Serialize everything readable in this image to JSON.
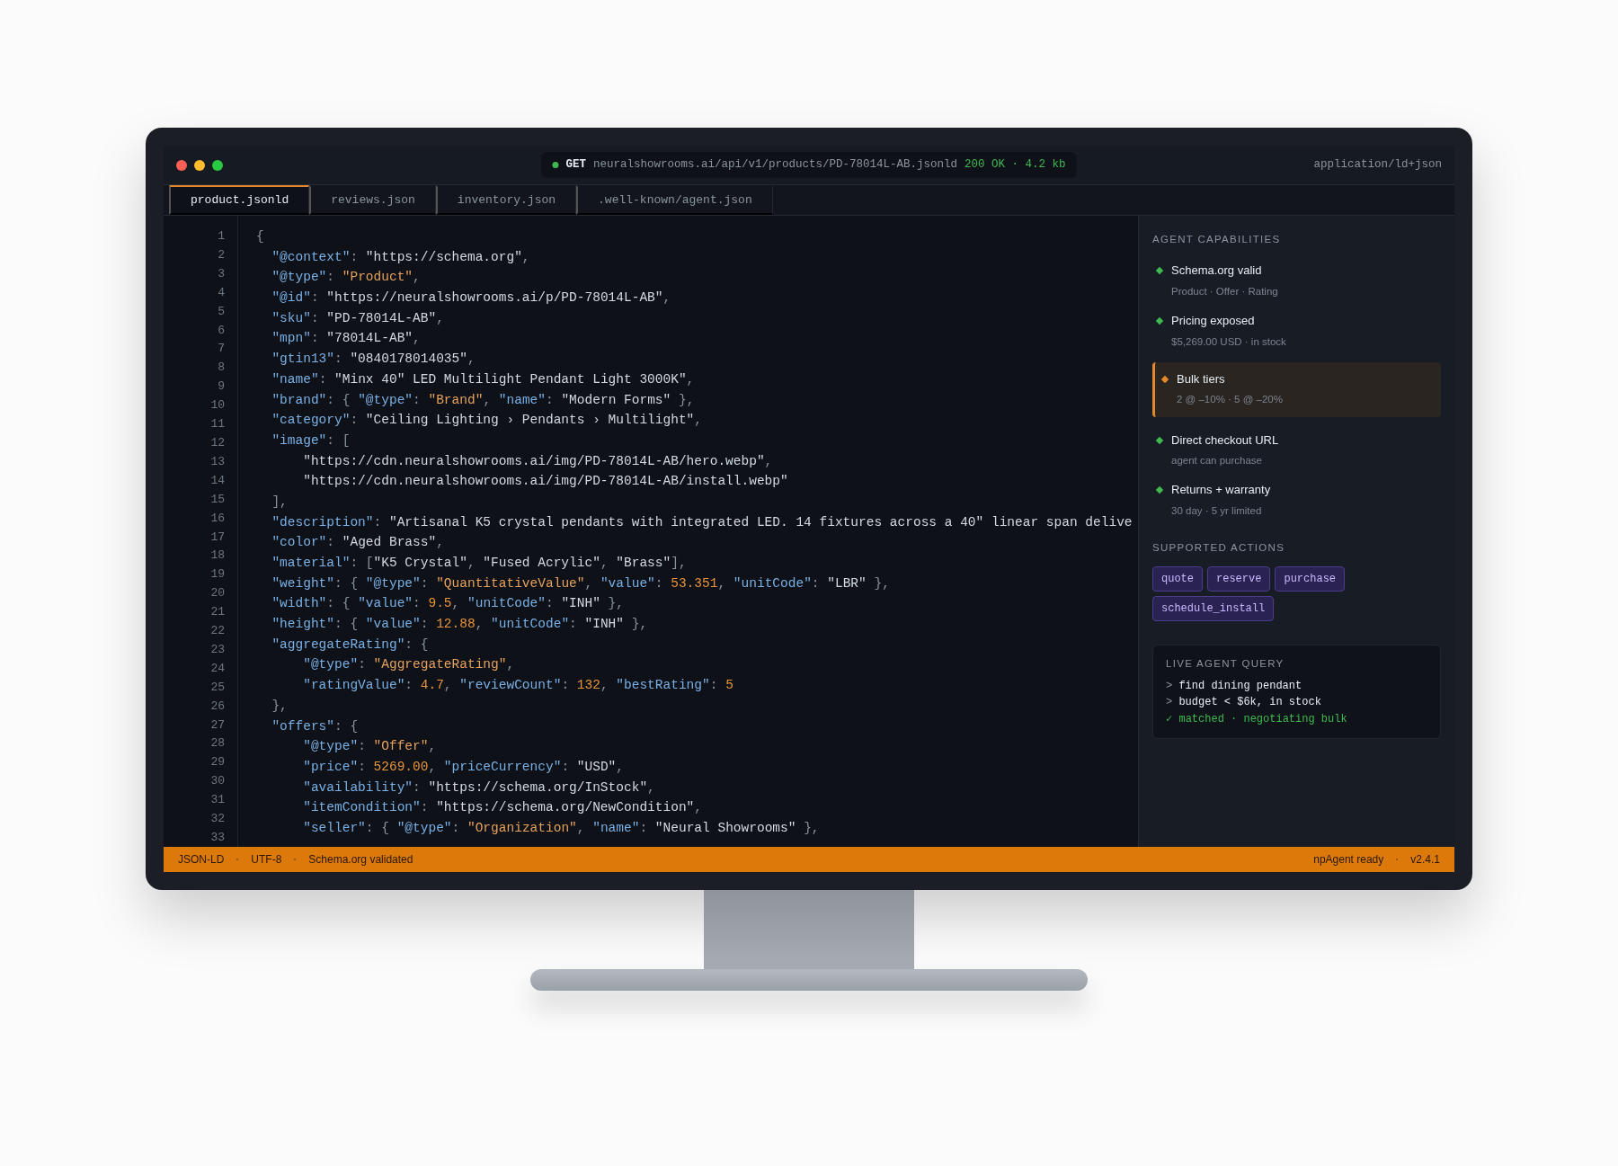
{
  "title_bar": {
    "method": "GET",
    "url": "neuralshowrooms.ai/api/v1/products/PD-78014L-AB.jsonld",
    "response": "200 OK · 4.2 kb",
    "content_type": "application/ld+json"
  },
  "tabs": [
    {
      "label": "product.jsonld",
      "selected": true
    },
    {
      "label": "reviews.json",
      "selected": false
    },
    {
      "label": "inventory.json",
      "selected": false
    },
    {
      "label": ".well-known/agent.json",
      "selected": false
    }
  ],
  "editor": {
    "line_numbers": [
      "1",
      "2",
      "3",
      "4",
      "5",
      "6",
      "7",
      "8",
      "9",
      "10",
      "11",
      "12",
      "13",
      "14",
      "15",
      "16",
      "17",
      "18",
      "19",
      "20",
      "21",
      "22",
      "23",
      "24",
      "25",
      "26",
      "27",
      "28",
      "29",
      "30",
      "31",
      "32",
      "33"
    ],
    "lines": [
      [
        {
          "kind": "punct",
          "text": "{"
        }
      ],
      [
        {
          "kind": "key",
          "text": "  \"@context\""
        },
        {
          "kind": "punct",
          "text": ": "
        },
        {
          "kind": "string",
          "text": "\"https://schema.org\""
        },
        {
          "kind": "punct",
          "text": ","
        }
      ],
      [
        {
          "kind": "key",
          "text": "  \"@type\""
        },
        {
          "kind": "punct",
          "text": ": "
        },
        {
          "kind": "type",
          "text": "\"Product\""
        },
        {
          "kind": "punct",
          "text": ","
        }
      ],
      [
        {
          "kind": "key",
          "text": "  \"@id\""
        },
        {
          "kind": "punct",
          "text": ": "
        },
        {
          "kind": "string",
          "text": "\"https://neuralshowrooms.ai/p/PD-78014L-AB\""
        },
        {
          "kind": "punct",
          "text": ","
        }
      ],
      [
        {
          "kind": "key",
          "text": "  \"sku\""
        },
        {
          "kind": "punct",
          "text": ": "
        },
        {
          "kind": "string",
          "text": "\"PD-78014L-AB\""
        },
        {
          "kind": "punct",
          "text": ","
        }
      ],
      [
        {
          "kind": "key",
          "text": "  \"mpn\""
        },
        {
          "kind": "punct",
          "text": ": "
        },
        {
          "kind": "string",
          "text": "\"78014L-AB\""
        },
        {
          "kind": "punct",
          "text": ","
        }
      ],
      [
        {
          "kind": "key",
          "text": "  \"gtin13\""
        },
        {
          "kind": "punct",
          "text": ": "
        },
        {
          "kind": "string",
          "text": "\"0840178014035\""
        },
        {
          "kind": "punct",
          "text": ","
        }
      ],
      [
        {
          "kind": "key",
          "text": "  \"name\""
        },
        {
          "kind": "punct",
          "text": ": "
        },
        {
          "kind": "string",
          "text": "\"Minx 40\" LED Multilight Pendant Light 3000K\""
        },
        {
          "kind": "punct",
          "text": ","
        }
      ],
      [
        {
          "kind": "key",
          "text": "  \"brand\""
        },
        {
          "kind": "punct",
          "text": ": { "
        },
        {
          "kind": "key",
          "text": "\"@type\""
        },
        {
          "kind": "punct",
          "text": ": "
        },
        {
          "kind": "type",
          "text": "\"Brand\""
        },
        {
          "kind": "punct",
          "text": ", "
        },
        {
          "kind": "key",
          "text": "\"name\""
        },
        {
          "kind": "punct",
          "text": ": "
        },
        {
          "kind": "string",
          "text": "\"Modern Forms\""
        },
        {
          "kind": "punct",
          "text": " },"
        }
      ],
      [
        {
          "kind": "key",
          "text": "  \"category\""
        },
        {
          "kind": "punct",
          "text": ": "
        },
        {
          "kind": "string",
          "text": "\"Ceiling Lighting › Pendants › Multilight\""
        },
        {
          "kind": "punct",
          "text": ","
        }
      ],
      [
        {
          "kind": "key",
          "text": "  \"image\""
        },
        {
          "kind": "punct",
          "text": ": ["
        }
      ],
      [
        {
          "kind": "string",
          "text": "      \"https://cdn.neuralshowrooms.ai/img/PD-78014L-AB/hero.webp\""
        },
        {
          "kind": "punct",
          "text": ","
        }
      ],
      [
        {
          "kind": "string",
          "text": "      \"https://cdn.neuralshowrooms.ai/img/PD-78014L-AB/install.webp\""
        }
      ],
      [
        {
          "kind": "punct",
          "text": "  ],"
        }
      ],
      [
        {
          "kind": "key",
          "text": "  \"description\""
        },
        {
          "kind": "punct",
          "text": ": "
        },
        {
          "kind": "string",
          "text": "\"Artisanal K5 crystal pendants with integrated LED. 14 fixtures across a 40\" linear span delive"
        }
      ],
      [
        {
          "kind": "key",
          "text": "  \"color\""
        },
        {
          "kind": "punct",
          "text": ": "
        },
        {
          "kind": "string",
          "text": "\"Aged Brass\""
        },
        {
          "kind": "punct",
          "text": ","
        }
      ],
      [
        {
          "kind": "key",
          "text": "  \"material\""
        },
        {
          "kind": "punct",
          "text": ": ["
        },
        {
          "kind": "string",
          "text": "\"K5 Crystal\""
        },
        {
          "kind": "punct",
          "text": ", "
        },
        {
          "kind": "string",
          "text": "\"Fused Acrylic\""
        },
        {
          "kind": "punct",
          "text": ", "
        },
        {
          "kind": "string",
          "text": "\"Brass\""
        },
        {
          "kind": "punct",
          "text": "],"
        }
      ],
      [
        {
          "kind": "key",
          "text": "  \"weight\""
        },
        {
          "kind": "punct",
          "text": ": { "
        },
        {
          "kind": "key",
          "text": "\"@type\""
        },
        {
          "kind": "punct",
          "text": ": "
        },
        {
          "kind": "type",
          "text": "\"QuantitativeValue\""
        },
        {
          "kind": "punct",
          "text": ", "
        },
        {
          "kind": "key",
          "text": "\"value\""
        },
        {
          "kind": "punct",
          "text": ": "
        },
        {
          "kind": "number",
          "text": "53.351"
        },
        {
          "kind": "punct",
          "text": ", "
        },
        {
          "kind": "key",
          "text": "\"unitCode\""
        },
        {
          "kind": "punct",
          "text": ": "
        },
        {
          "kind": "string",
          "text": "\"LBR\""
        },
        {
          "kind": "punct",
          "text": " },"
        }
      ],
      [
        {
          "kind": "key",
          "text": "  \"width\""
        },
        {
          "kind": "punct",
          "text": ": { "
        },
        {
          "kind": "key",
          "text": "\"value\""
        },
        {
          "kind": "punct",
          "text": ": "
        },
        {
          "kind": "number",
          "text": "9.5"
        },
        {
          "kind": "punct",
          "text": ", "
        },
        {
          "kind": "key",
          "text": "\"unitCode\""
        },
        {
          "kind": "punct",
          "text": ": "
        },
        {
          "kind": "string",
          "text": "\"INH\""
        },
        {
          "kind": "punct",
          "text": " },"
        }
      ],
      [
        {
          "kind": "key",
          "text": "  \"height\""
        },
        {
          "kind": "punct",
          "text": ": { "
        },
        {
          "kind": "key",
          "text": "\"value\""
        },
        {
          "kind": "punct",
          "text": ": "
        },
        {
          "kind": "number",
          "text": "12.88"
        },
        {
          "kind": "punct",
          "text": ", "
        },
        {
          "kind": "key",
          "text": "\"unitCode\""
        },
        {
          "kind": "punct",
          "text": ": "
        },
        {
          "kind": "string",
          "text": "\"INH\""
        },
        {
          "kind": "punct",
          "text": " },"
        }
      ],
      [
        {
          "kind": "key",
          "text": "  \"aggregateRating\""
        },
        {
          "kind": "punct",
          "text": ": {"
        }
      ],
      [
        {
          "kind": "key",
          "text": "      \"@type\""
        },
        {
          "kind": "punct",
          "text": ": "
        },
        {
          "kind": "type",
          "text": "\"AggregateRating\""
        },
        {
          "kind": "punct",
          "text": ","
        }
      ],
      [
        {
          "kind": "key",
          "text": "      \"ratingValue\""
        },
        {
          "kind": "punct",
          "text": ": "
        },
        {
          "kind": "number",
          "text": "4.7"
        },
        {
          "kind": "punct",
          "text": ", "
        },
        {
          "kind": "key",
          "text": "\"reviewCount\""
        },
        {
          "kind": "punct",
          "text": ": "
        },
        {
          "kind": "number",
          "text": "132"
        },
        {
          "kind": "punct",
          "text": ", "
        },
        {
          "kind": "key",
          "text": "\"bestRating\""
        },
        {
          "kind": "punct",
          "text": ": "
        },
        {
          "kind": "number",
          "text": "5"
        }
      ],
      [
        {
          "kind": "punct",
          "text": "  },"
        }
      ],
      [
        {
          "kind": "key",
          "text": "  \"offers\""
        },
        {
          "kind": "punct",
          "text": ": {"
        }
      ],
      [
        {
          "kind": "key",
          "text": "      \"@type\""
        },
        {
          "kind": "punct",
          "text": ": "
        },
        {
          "kind": "type",
          "text": "\"Offer\""
        },
        {
          "kind": "punct",
          "text": ","
        }
      ],
      [
        {
          "kind": "key",
          "text": "      \"price\""
        },
        {
          "kind": "punct",
          "text": ": "
        },
        {
          "kind": "number",
          "text": "5269.00"
        },
        {
          "kind": "punct",
          "text": ", "
        },
        {
          "kind": "key",
          "text": "\"priceCurrency\""
        },
        {
          "kind": "punct",
          "text": ": "
        },
        {
          "kind": "string",
          "text": "\"USD\""
        },
        {
          "kind": "punct",
          "text": ","
        }
      ],
      [
        {
          "kind": "key",
          "text": "      \"availability\""
        },
        {
          "kind": "punct",
          "text": ": "
        },
        {
          "kind": "string",
          "text": "\"https://schema.org/InStock\""
        },
        {
          "kind": "punct",
          "text": ","
        }
      ],
      [
        {
          "kind": "key",
          "text": "      \"itemCondition\""
        },
        {
          "kind": "punct",
          "text": ": "
        },
        {
          "kind": "string",
          "text": "\"https://schema.org/NewCondition\""
        },
        {
          "kind": "punct",
          "text": ","
        }
      ],
      [
        {
          "kind": "key",
          "text": "      \"seller\""
        },
        {
          "kind": "punct",
          "text": ": { "
        },
        {
          "kind": "key",
          "text": "\"@type\""
        },
        {
          "kind": "punct",
          "text": ": "
        },
        {
          "kind": "type",
          "text": "\"Organization\""
        },
        {
          "kind": "punct",
          "text": ", "
        },
        {
          "kind": "key",
          "text": "\"name\""
        },
        {
          "kind": "punct",
          "text": ": "
        },
        {
          "kind": "string",
          "text": "\"Neural Showrooms\""
        },
        {
          "kind": "punct",
          "text": " },"
        }
      ]
    ]
  },
  "sidebar": {
    "capabilities_title": "AGENT CAPABILITIES",
    "capabilities": [
      {
        "title": "Schema.org valid",
        "detail": "Product · Offer · Rating",
        "color": "#3fb950",
        "highlighted": false
      },
      {
        "title": "Pricing exposed",
        "detail": "$5,269.00 USD · in stock",
        "color": "#3fb950",
        "highlighted": false
      },
      {
        "title": "Bulk tiers",
        "detail": "2 @ –10% · 5 @ –20%",
        "color": "#e3892b",
        "highlighted": true
      },
      {
        "title": "Direct checkout URL",
        "detail": "agent can purchase",
        "color": "#3fb950",
        "highlighted": false
      },
      {
        "title": "Returns + warranty",
        "detail": "30 day · 5 yr limited",
        "color": "#3fb950",
        "highlighted": false
      }
    ],
    "actions_title": "SUPPORTED ACTIONS",
    "actions": [
      "quote",
      "reserve",
      "purchase",
      "schedule_install"
    ],
    "query": {
      "title": "LIVE AGENT QUERY",
      "lines": [
        {
          "kind": "input",
          "mark": ">",
          "text": "find dining pendant"
        },
        {
          "kind": "input",
          "mark": ">",
          "text": "budget < $6k, in stock"
        },
        {
          "kind": "result",
          "mark": "✓",
          "text": "matched · negotiating bulk"
        }
      ]
    }
  },
  "status_bar": {
    "left": [
      "JSON-LD",
      "UTF-8",
      "Schema.org validated"
    ],
    "right": [
      "npAgent ready",
      "v2.4.1"
    ]
  }
}
